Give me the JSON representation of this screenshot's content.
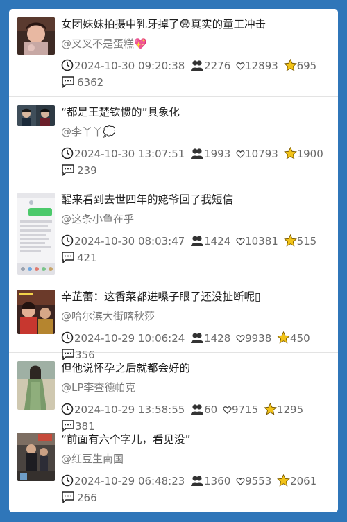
{
  "items": [
    {
      "title": "女团妹妹拍摄中乳牙掉了😨真实的童工冲击",
      "author": "@叉叉不是蛋糕💖",
      "datetime": "2024-10-30 09:20:38",
      "users": "2276",
      "likes": "12893",
      "stars": "695",
      "comments": "6362"
    },
    {
      "title": "“都是王楚钦惯的”具象化",
      "author": "@李丫丫💭",
      "datetime": "2024-10-30 13:07:51",
      "users": "1993",
      "likes": "10793",
      "stars": "1900",
      "comments": "239"
    },
    {
      "title": "醒来看到去世四年的姥爷回了我短信",
      "author": "@这条小鱼在乎",
      "datetime": "2024-10-30 08:03:47",
      "users": "1424",
      "likes": "10381",
      "stars": "515",
      "comments": "421"
    },
    {
      "title": "辛芷蕾：这香菜都进嗓子眼了还没扯断呢▯",
      "author": "@哈尔滨大街喀秋莎",
      "datetime": "2024-10-29 10:06:24",
      "users": "1428",
      "likes": "9938",
      "stars": "450",
      "comments": "356"
    },
    {
      "title": "但他说怀孕之后就都会好的",
      "author": "@LP李查德帕克",
      "datetime": "2024-10-29 13:58:55",
      "users": "60",
      "likes": "9715",
      "stars": "1295",
      "comments": "381"
    },
    {
      "title": "“前面有六个字儿，看见没”",
      "author": "@红豆生南国",
      "datetime": "2024-10-29 06:48:23",
      "users": "1360",
      "likes": "9553",
      "stars": "2061",
      "comments": "266"
    }
  ],
  "icons": {
    "clock": "clock-icon",
    "users": "users-icon",
    "like": "heart-icon",
    "star": "star-icon",
    "comment": "comment-icon"
  },
  "colors": {
    "background": "#2f76b9",
    "card": "#ffffff",
    "star": "#f2c318"
  }
}
